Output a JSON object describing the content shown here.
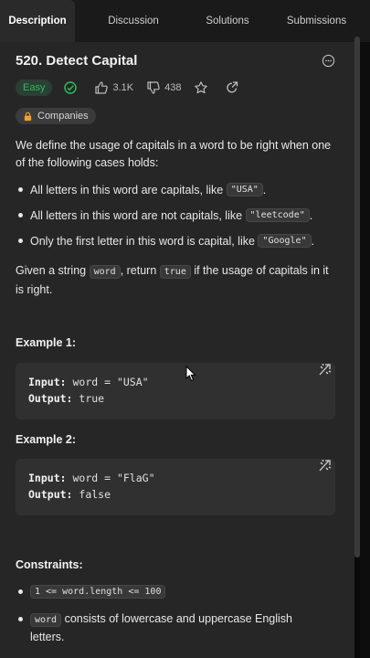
{
  "tabs": [
    {
      "label": "Description",
      "active": true
    },
    {
      "label": "Discussion"
    },
    {
      "label": "Solutions"
    },
    {
      "label": "Submissions"
    }
  ],
  "problem": {
    "title": "520. Detect Capital",
    "difficulty": "Easy",
    "likes": "3.1K",
    "dislikes": "438",
    "companies_label": "Companies"
  },
  "description": {
    "intro": "We define the usage of capitals in a word to be right when one of the following cases holds:",
    "bullets": [
      {
        "text": "All letters in this word are capitals, like ",
        "code": "\"USA\"",
        "suffix": "."
      },
      {
        "text": "All letters in this word are not capitals, like ",
        "code": "\"leetcode\"",
        "suffix": "."
      },
      {
        "text": "Only the first letter in this word is capital, like ",
        "code": "\"Google\"",
        "suffix": "."
      }
    ],
    "task_pre": "Given a string ",
    "task_code1": "word",
    "task_mid": ", return ",
    "task_code2": "true",
    "task_post": " if the usage of capitals in it is right."
  },
  "examples": [
    {
      "heading": "Example 1:",
      "input_label": "Input:",
      "input_value": "word = \"USA\"",
      "output_label": "Output:",
      "output_value": "true"
    },
    {
      "heading": "Example 2:",
      "input_label": "Input:",
      "input_value": "word = \"FlaG\"",
      "output_label": "Output:",
      "output_value": "false"
    }
  ],
  "constraints": {
    "heading": "Constraints:",
    "items": [
      {
        "code": "1 <= word.length <= 100",
        "text": ""
      },
      {
        "code": "word",
        "text": " consists of lowercase and uppercase English letters."
      }
    ]
  },
  "colors": {
    "easy": "#2cbb5d",
    "background": "#262626",
    "tab_bar": "#1a1a1a"
  }
}
